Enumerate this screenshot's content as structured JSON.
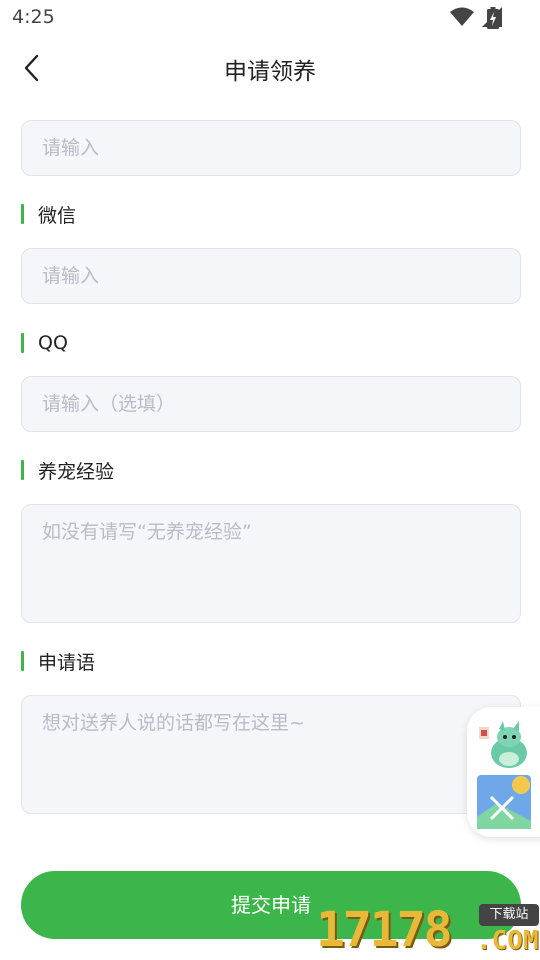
{
  "status": {
    "time": "4:25"
  },
  "header": {
    "title": "申请领养"
  },
  "form": {
    "field1": {
      "placeholder": "请输入"
    },
    "wechat": {
      "label": "微信",
      "placeholder": "请输入"
    },
    "qq": {
      "label": "QQ",
      "placeholder": "请输入（选填）"
    },
    "experience": {
      "label": "养宠经验",
      "placeholder": "如没有请写“无养宠经验”"
    },
    "message": {
      "label": "申请语",
      "placeholder": "想对送养人说的话都写在这里~"
    }
  },
  "submit": {
    "label": "提交申请"
  },
  "watermark": {
    "number": "17178",
    "domain": ".COM",
    "tag": "下载站"
  },
  "colors": {
    "accent": "#3cb54a",
    "field_bg": "#f5f6f9",
    "placeholder": "#b8bcc6"
  },
  "icons": {
    "back": "chevron-left-icon",
    "wifi": "wifi-icon",
    "signal": "signal-icon",
    "battery": "battery-charging-icon"
  }
}
